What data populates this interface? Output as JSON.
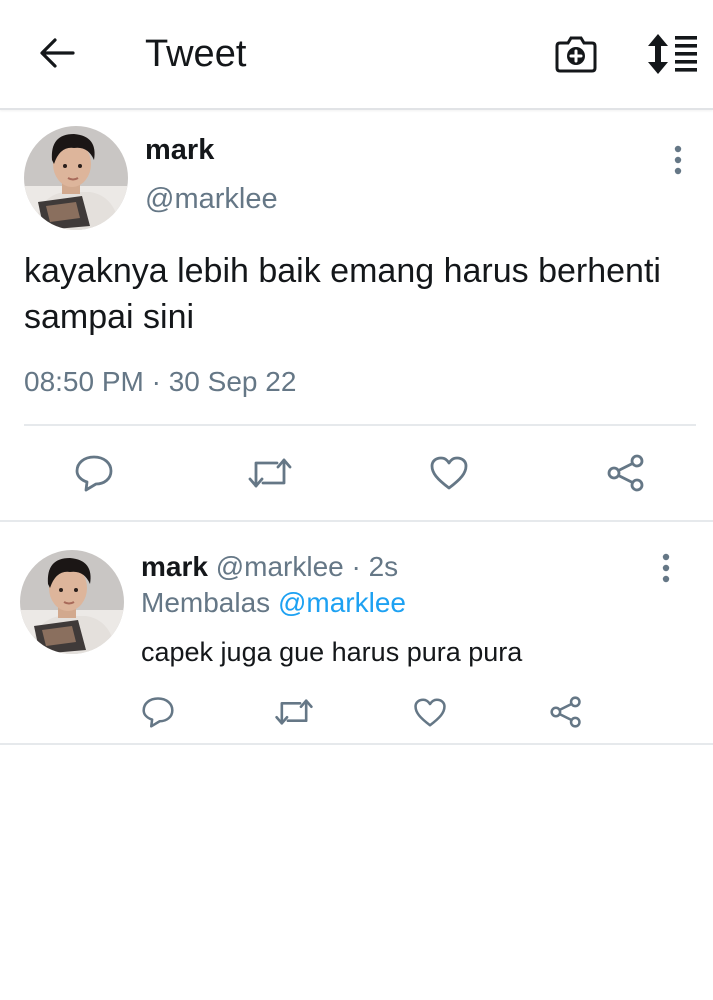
{
  "header": {
    "title": "Tweet",
    "back_icon": "arrow-left-icon",
    "camera_icon": "camera-plus-icon",
    "sort_icon": "sort-list-icon"
  },
  "main_tweet": {
    "name": "mark",
    "handle": "@marklee",
    "text": "kayaknya lebih baik emang harus berhenti sampai sini",
    "timestamp": "08:50 PM · 30 Sep 22",
    "more_icon": "more-vertical-icon",
    "actions": [
      "reply-icon",
      "retweet-icon",
      "like-icon",
      "share-icon"
    ]
  },
  "reply_tweet": {
    "name": "mark",
    "handle_time": "@marklee · 2s",
    "replying_label": "Membalas",
    "replying_to": "@marklee",
    "text": "capek juga gue harus pura pura",
    "more_icon": "more-vertical-icon",
    "actions": [
      "reply-icon",
      "retweet-icon",
      "like-icon",
      "share-icon"
    ]
  },
  "colors": {
    "text": "#14171a",
    "muted": "#657786",
    "link": "#1da1f2",
    "divider": "#e6e9ec"
  }
}
